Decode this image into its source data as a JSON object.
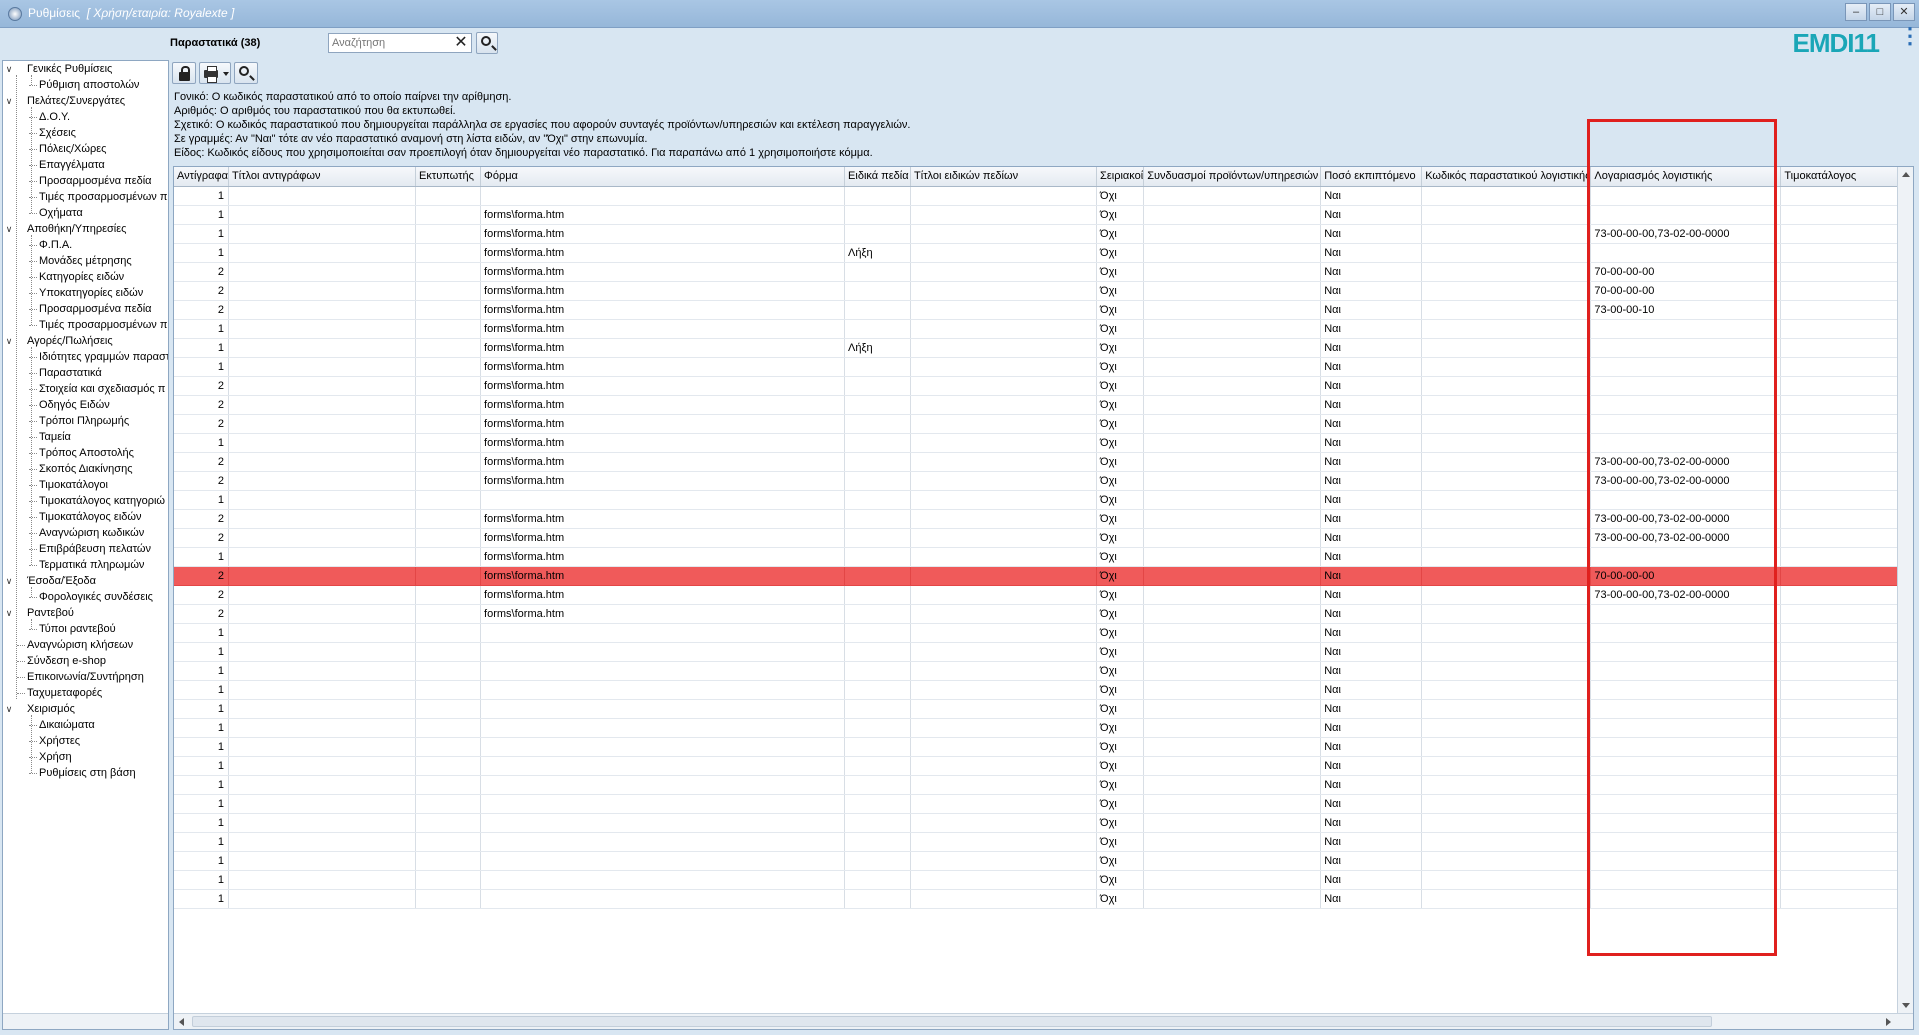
{
  "window": {
    "title_main": "Ρυθμίσεις",
    "title_sub": "[ Χρήση/εταιρία: Royalexte ]",
    "minimize_glyph": "–",
    "maximize_glyph": "□",
    "close_glyph": "✕"
  },
  "topbar": {
    "docs_label": "Παραστατικά (38)",
    "search_placeholder": "Αναζήτηση",
    "clear_glyph": "✕",
    "logo_text": "EMDI11",
    "kebab_glyph": "⋮"
  },
  "tree": {
    "items": [
      {
        "label": "Γενικές Ρυθμίσεις",
        "level": 0,
        "toggle": "∨"
      },
      {
        "label": "Ρύθμιση αποστολών",
        "level": 1
      },
      {
        "label": "Πελάτες/Συνεργάτες",
        "level": 0,
        "toggle": "∨"
      },
      {
        "label": "Δ.Ο.Υ.",
        "level": 1
      },
      {
        "label": "Σχέσεις",
        "level": 1
      },
      {
        "label": "Πόλεις/Χώρες",
        "level": 1
      },
      {
        "label": "Επαγγέλματα",
        "level": 1
      },
      {
        "label": "Προσαρμοσμένα πεδία",
        "level": 1
      },
      {
        "label": "Τιμές προσαρμοσμένων π",
        "level": 1
      },
      {
        "label": "Οχήματα",
        "level": 1
      },
      {
        "label": "Αποθήκη/Υπηρεσίες",
        "level": 0,
        "toggle": "∨"
      },
      {
        "label": "Φ.Π.Α.",
        "level": 1
      },
      {
        "label": "Μονάδες μέτρησης",
        "level": 1
      },
      {
        "label": "Κατηγορίες ειδών",
        "level": 1
      },
      {
        "label": "Υποκατηγορίες ειδών",
        "level": 1
      },
      {
        "label": "Προσαρμοσμένα πεδία",
        "level": 1
      },
      {
        "label": "Τιμές προσαρμοσμένων π",
        "level": 1
      },
      {
        "label": "Αγορές/Πωλήσεις",
        "level": 0,
        "toggle": "∨"
      },
      {
        "label": "Ιδιότητες γραμμών παραστ",
        "level": 1
      },
      {
        "label": "Παραστατικά",
        "level": 1
      },
      {
        "label": "Στοιχεία και σχεδιασμός π",
        "level": 1
      },
      {
        "label": "Οδηγός Ειδών",
        "level": 1
      },
      {
        "label": "Τρόποι Πληρωμής",
        "level": 1
      },
      {
        "label": "Ταμεία",
        "level": 1
      },
      {
        "label": "Τρόπος Αποστολής",
        "level": 1
      },
      {
        "label": "Σκοπός Διακίνησης",
        "level": 1
      },
      {
        "label": "Τιμοκατάλογοι",
        "level": 1
      },
      {
        "label": "Τιμοκατάλογος κατηγοριώ",
        "level": 1
      },
      {
        "label": "Τιμοκατάλογος ειδών",
        "level": 1
      },
      {
        "label": "Αναγνώριση κωδικών",
        "level": 1
      },
      {
        "label": "Επιβράβευση πελατών",
        "level": 1
      },
      {
        "label": "Τερματικά πληρωμών",
        "level": 1
      },
      {
        "label": "Έσοδα/Έξοδα",
        "level": 0,
        "toggle": "∨"
      },
      {
        "label": "Φορολογικές συνδέσεις",
        "level": 1
      },
      {
        "label": "Ραντεβού",
        "level": 0,
        "toggle": "∨"
      },
      {
        "label": "Τύποι ραντεβού",
        "level": 1
      },
      {
        "label": "Αναγνώριση κλήσεων",
        "level": 0
      },
      {
        "label": "Σύνδεση e-shop",
        "level": 0
      },
      {
        "label": "Επικοινωνία/Συντήρηση",
        "level": 0
      },
      {
        "label": "Ταχυμεταφορές",
        "level": 0
      },
      {
        "label": "Χειρισμός",
        "level": 0,
        "toggle": "∨"
      },
      {
        "label": "Δικαιώματα",
        "level": 1
      },
      {
        "label": "Χρήστες",
        "level": 1
      },
      {
        "label": "Χρήση",
        "level": 1
      },
      {
        "label": "Ρυθμίσεις στη βάση",
        "level": 1
      }
    ]
  },
  "help_lines": [
    "Γονικό: Ο κωδικός παραστατικού από το οποίο παίρνει την αρίθμηση.",
    "Αριθμός: Ο αριθμός του παραστατικού που θα εκτυπωθεί.",
    "Σχετικό: Ο κωδικός παραστατικού που δημιουργείται παράλληλα σε εργασίες που αφορούν συνταγές προϊόντων/υπηρεσιών και εκτέλεση παραγγελιών.",
    "Σε γραμμές: Αν \"Ναι\" τότε αν νέο παραστατικό αναμονή στη λίστα ειδών, αν \"Όχι\" στην επωνυμία.",
    "Είδος: Κωδικός είδους που χρησιμοποιείται σαν προεπιλογή όταν δημιουργείται νέο παραστατικό. Για παραπάνω από 1 χρησιμοποιήστε κόμμα."
  ],
  "grid": {
    "columns": [
      "Αντίγραφα",
      "Τίτλοι αντιγράφων",
      "Εκτυπωτής",
      "Φόρμα",
      "Ειδικά πεδία",
      "Τίτλοι ειδικών πεδίων",
      "Σειριακοί",
      "Συνδυασμοί προϊόντων/υπηρεσιών",
      "Ποσό εκπιπτόμενο",
      "Κωδικός παραστατικού λογιστικής",
      "Λογαριασμός λογιστικής",
      "Τιμοκατάλογος"
    ],
    "selected_row": 20,
    "rows": [
      [
        "1",
        "",
        "",
        "",
        "",
        "",
        "Όχι",
        "",
        "Ναι",
        "",
        "",
        ""
      ],
      [
        "1",
        "",
        "",
        "forms\\forma.htm",
        "",
        "",
        "Όχι",
        "",
        "Ναι",
        "",
        "",
        ""
      ],
      [
        "1",
        "",
        "",
        "forms\\forma.htm",
        "",
        "",
        "Όχι",
        "",
        "Ναι",
        "",
        "73-00-00-00,73-02-00-0000",
        ""
      ],
      [
        "1",
        "",
        "",
        "forms\\forma.htm",
        "Λήξη",
        "",
        "Όχι",
        "",
        "Ναι",
        "",
        "",
        ""
      ],
      [
        "2",
        "",
        "",
        "forms\\forma.htm",
        "",
        "",
        "Όχι",
        "",
        "Ναι",
        "",
        "70-00-00-00",
        ""
      ],
      [
        "2",
        "",
        "",
        "forms\\forma.htm",
        "",
        "",
        "Όχι",
        "",
        "Ναι",
        "",
        "70-00-00-00",
        ""
      ],
      [
        "2",
        "",
        "",
        "forms\\forma.htm",
        "",
        "",
        "Όχι",
        "",
        "Ναι",
        "",
        "73-00-00-10",
        ""
      ],
      [
        "1",
        "",
        "",
        "forms\\forma.htm",
        "",
        "",
        "Όχι",
        "",
        "Ναι",
        "",
        "",
        ""
      ],
      [
        "1",
        "",
        "",
        "forms\\forma.htm",
        "Λήξη",
        "",
        "Όχι",
        "",
        "Ναι",
        "",
        "",
        ""
      ],
      [
        "1",
        "",
        "",
        "forms\\forma.htm",
        "",
        "",
        "Όχι",
        "",
        "Ναι",
        "",
        "",
        ""
      ],
      [
        "2",
        "",
        "",
        "forms\\forma.htm",
        "",
        "",
        "Όχι",
        "",
        "Ναι",
        "",
        "",
        ""
      ],
      [
        "2",
        "",
        "",
        "forms\\forma.htm",
        "",
        "",
        "Όχι",
        "",
        "Ναι",
        "",
        "",
        ""
      ],
      [
        "2",
        "",
        "",
        "forms\\forma.htm",
        "",
        "",
        "Όχι",
        "",
        "Ναι",
        "",
        "",
        ""
      ],
      [
        "1",
        "",
        "",
        "forms\\forma.htm",
        "",
        "",
        "Όχι",
        "",
        "Ναι",
        "",
        "",
        ""
      ],
      [
        "2",
        "",
        "",
        "forms\\forma.htm",
        "",
        "",
        "Όχι",
        "",
        "Ναι",
        "",
        "73-00-00-00,73-02-00-0000",
        ""
      ],
      [
        "2",
        "",
        "",
        "forms\\forma.htm",
        "",
        "",
        "Όχι",
        "",
        "Ναι",
        "",
        "73-00-00-00,73-02-00-0000",
        ""
      ],
      [
        "1",
        "",
        "",
        "",
        "",
        "",
        "Όχι",
        "",
        "Ναι",
        "",
        "",
        ""
      ],
      [
        "2",
        "",
        "",
        "forms\\forma.htm",
        "",
        "",
        "Όχι",
        "",
        "Ναι",
        "",
        "73-00-00-00,73-02-00-0000",
        ""
      ],
      [
        "2",
        "",
        "",
        "forms\\forma.htm",
        "",
        "",
        "Όχι",
        "",
        "Ναι",
        "",
        "73-00-00-00,73-02-00-0000",
        ""
      ],
      [
        "1",
        "",
        "",
        "forms\\forma.htm",
        "",
        "",
        "Όχι",
        "",
        "Ναι",
        "",
        "",
        ""
      ],
      [
        "2",
        "",
        "",
        "forms\\forma.htm",
        "",
        "",
        "Όχι",
        "",
        "Ναι",
        "",
        "70-00-00-00",
        ""
      ],
      [
        "2",
        "",
        "",
        "forms\\forma.htm",
        "",
        "",
        "Όχι",
        "",
        "Ναι",
        "",
        "73-00-00-00,73-02-00-0000",
        ""
      ],
      [
        "2",
        "",
        "",
        "forms\\forma.htm",
        "",
        "",
        "Όχι",
        "",
        "Ναι",
        "",
        "",
        ""
      ],
      [
        "1",
        "",
        "",
        "",
        "",
        "",
        "Όχι",
        "",
        "Ναι",
        "",
        "",
        ""
      ],
      [
        "1",
        "",
        "",
        "",
        "",
        "",
        "Όχι",
        "",
        "Ναι",
        "",
        "",
        ""
      ],
      [
        "1",
        "",
        "",
        "",
        "",
        "",
        "Όχι",
        "",
        "Ναι",
        "",
        "",
        ""
      ],
      [
        "1",
        "",
        "",
        "",
        "",
        "",
        "Όχι",
        "",
        "Ναι",
        "",
        "",
        ""
      ],
      [
        "1",
        "",
        "",
        "",
        "",
        "",
        "Όχι",
        "",
        "Ναι",
        "",
        "",
        ""
      ],
      [
        "1",
        "",
        "",
        "",
        "",
        "",
        "Όχι",
        "",
        "Ναι",
        "",
        "",
        ""
      ],
      [
        "1",
        "",
        "",
        "",
        "",
        "",
        "Όχι",
        "",
        "Ναι",
        "",
        "",
        ""
      ],
      [
        "1",
        "",
        "",
        "",
        "",
        "",
        "Όχι",
        "",
        "Ναι",
        "",
        "",
        ""
      ],
      [
        "1",
        "",
        "",
        "",
        "",
        "",
        "Όχι",
        "",
        "Ναι",
        "",
        "",
        ""
      ],
      [
        "1",
        "",
        "",
        "",
        "",
        "",
        "Όχι",
        "",
        "Ναι",
        "",
        "",
        ""
      ],
      [
        "1",
        "",
        "",
        "",
        "",
        "",
        "Όχι",
        "",
        "Ναι",
        "",
        "",
        ""
      ],
      [
        "1",
        "",
        "",
        "",
        "",
        "",
        "Όχι",
        "",
        "Ναι",
        "",
        "",
        ""
      ],
      [
        "1",
        "",
        "",
        "",
        "",
        "",
        "Όχι",
        "",
        "Ναι",
        "",
        "",
        ""
      ],
      [
        "1",
        "",
        "",
        "",
        "",
        "",
        "Όχι",
        "",
        "Ναι",
        "",
        "",
        ""
      ],
      [
        "1",
        "",
        "",
        "",
        "",
        "",
        "Όχι",
        "",
        "Ναι",
        "",
        "",
        ""
      ]
    ]
  },
  "colors": {
    "selected_row": "#f05a5a",
    "highlight_box": "#e0201e",
    "logo": "#1aa6b7"
  }
}
